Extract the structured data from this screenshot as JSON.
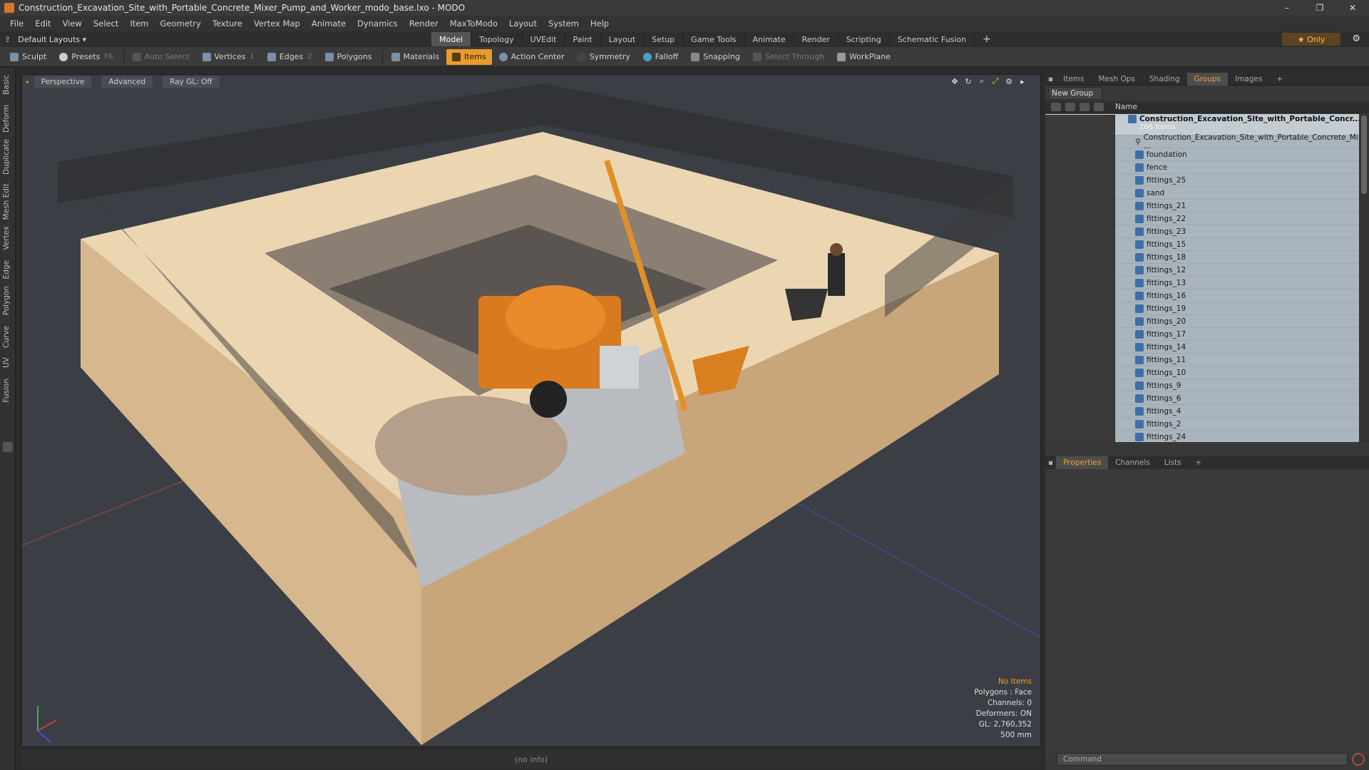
{
  "window": {
    "title": "Construction_Excavation_Site_with_Portable_Concrete_Mixer_Pump_and_Worker_modo_base.lxo - MODO"
  },
  "menu": [
    "File",
    "Edit",
    "View",
    "Select",
    "Item",
    "Geometry",
    "Texture",
    "Vertex Map",
    "Animate",
    "Dynamics",
    "Render",
    "MaxToModo",
    "Layout",
    "System",
    "Help"
  ],
  "layout_select": "Default Layouts",
  "mode_tabs": [
    "Model",
    "Topology",
    "UVEdit",
    "Paint",
    "Layout",
    "Setup",
    "Game Tools",
    "Animate",
    "Render",
    "Scripting",
    "Schematic Fusion"
  ],
  "only_label": "★ Only",
  "toolbar": {
    "sculpt": "Sculpt",
    "presets": "Presets",
    "presets_key": "F6",
    "auto_select": "Auto Select",
    "vertices": "Vertices",
    "vertices_key": "1",
    "edges": "Edges",
    "edges_key": "2",
    "polygons": "Polygons",
    "materials": "Materials",
    "items": "Items",
    "action_center": "Action Center",
    "symmetry": "Symmetry",
    "falloff": "Falloff",
    "snapping": "Snapping",
    "select_through": "Select Through",
    "workplane": "WorkPlane"
  },
  "left_tabs": [
    "Basic",
    "Deform",
    "Duplicate",
    "Mesh Edit",
    "Vertex",
    "Edge",
    "Polygon",
    "Curve",
    "UV",
    "Fusion"
  ],
  "viewport": {
    "perspective": "Perspective",
    "advanced": "Advanced",
    "raygl": "Ray GL: Off",
    "info": {
      "no_items": "No Items",
      "polygons": "Polygons : Face",
      "channels": "Channels: 0",
      "deformers": "Deformers: ON",
      "gl": "GL: 2,760,352",
      "scale": "500 mm"
    }
  },
  "status": "(no info)",
  "right_tabs": [
    "Items",
    "Mesh Ops",
    "Shading",
    "Groups",
    "Images"
  ],
  "new_group": "New Group",
  "list_header": "Name",
  "group": {
    "name": "Construction_Excavation_Site_with_Portable_Concr...",
    "count": "206 Items",
    "items": [
      "Construction_Excavation_Site_with_Portable_Concrete_Mi ...",
      "foundation",
      "fence",
      "fittings_25",
      "sand",
      "fittings_21",
      "fittings_22",
      "fittings_23",
      "fittings_15",
      "fittings_18",
      "fittings_12",
      "fittings_13",
      "fittings_16",
      "fittings_19",
      "fittings_20",
      "fittings_17",
      "fittings_14",
      "fittings_11",
      "fittings_10",
      "fittings_9",
      "fittings_6",
      "fittings_4",
      "fittings_2",
      "fittings_24"
    ]
  },
  "bottom_tabs": [
    "Properties",
    "Channels",
    "Lists"
  ],
  "command_placeholder": "Command",
  "colors": {
    "accent": "#e89a2f",
    "viewport_bg": "#3b3f45",
    "list_bg": "#aab4bd"
  }
}
